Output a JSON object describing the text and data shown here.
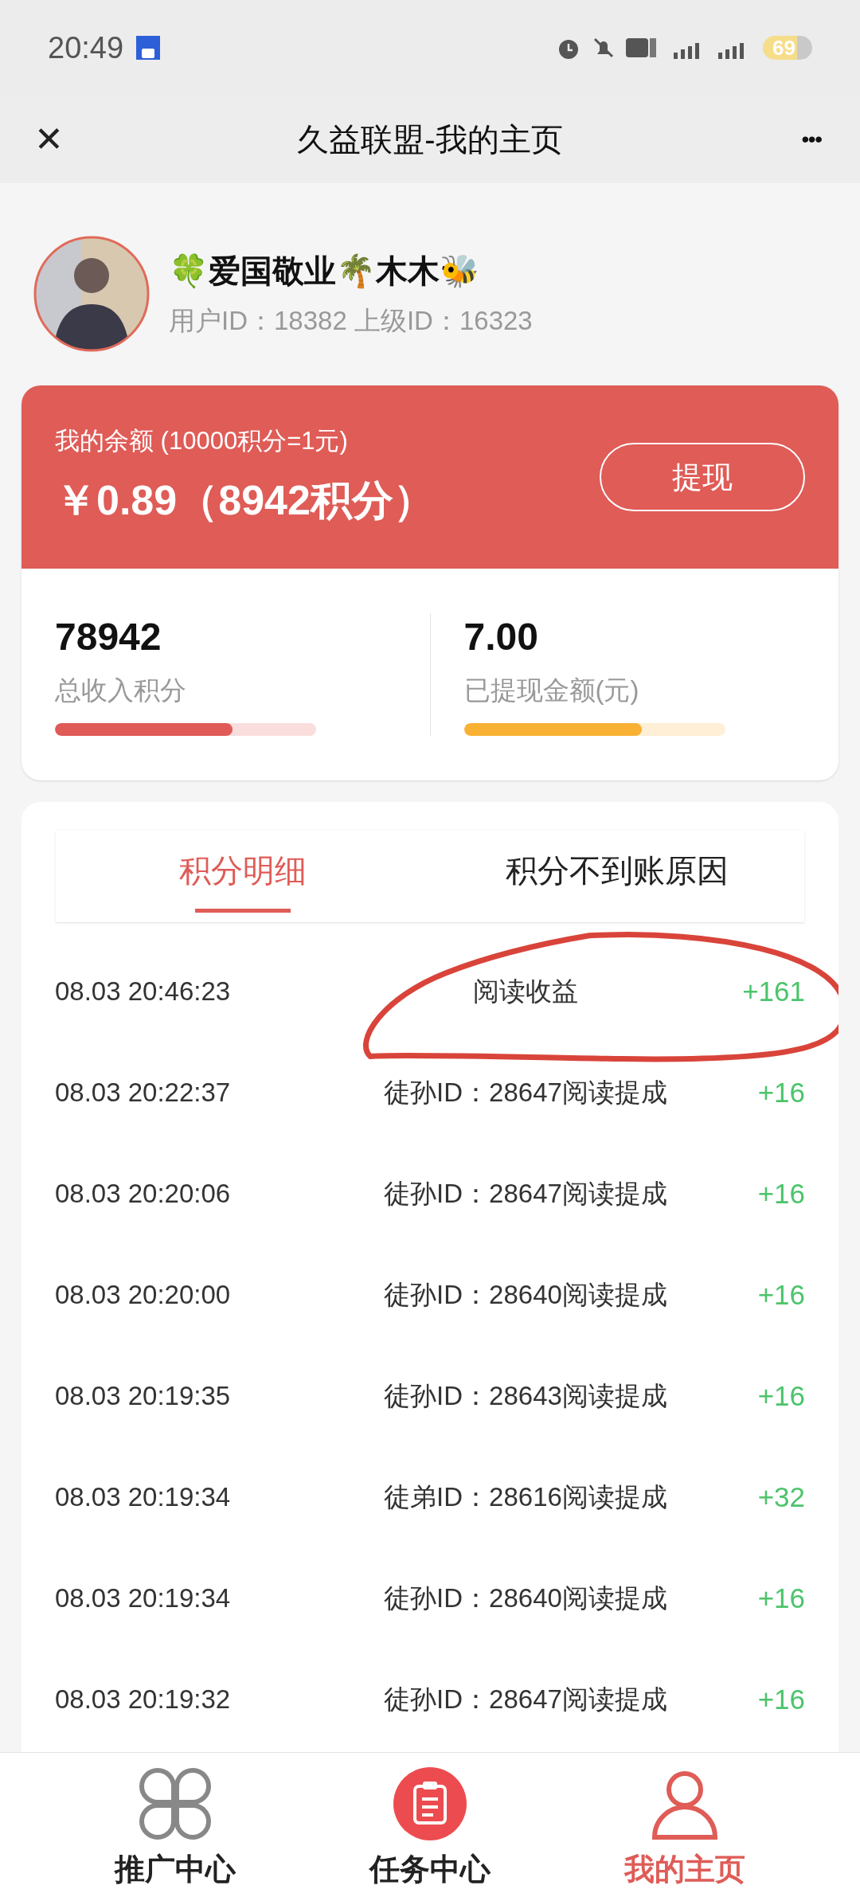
{
  "status_bar": {
    "time": "20:49",
    "battery": "69"
  },
  "header": {
    "close": "✕",
    "title": "久益联盟-我的主页",
    "more": "•••"
  },
  "profile": {
    "name": "🍀爱国敬业🌴木木🐝",
    "ids": "用户ID：18382 上级ID：16323"
  },
  "balance": {
    "label": "我的余额 (10000积分=1元)",
    "amount": "￥0.89（8942积分）",
    "button": "提现"
  },
  "stats": [
    {
      "value": "78942",
      "label": "总收入积分",
      "level": 0.68,
      "color": "#e05a57"
    },
    {
      "value": "7.00",
      "label": "已提现金额(元)",
      "level": 0.68,
      "color": "#f8b133"
    }
  ],
  "tabs": [
    {
      "label": "积分明细",
      "selected": true
    },
    {
      "label": "积分不到账原因",
      "selected": false
    }
  ],
  "records": [
    {
      "time": "08.03 20:46:23",
      "desc": "阅读收益",
      "amount": "+161"
    },
    {
      "time": "08.03 20:22:37",
      "desc": "徒孙ID：28647阅读提成",
      "amount": "+16"
    },
    {
      "time": "08.03 20:20:06",
      "desc": "徒孙ID：28647阅读提成",
      "amount": "+16"
    },
    {
      "time": "08.03 20:20:00",
      "desc": "徒孙ID：28640阅读提成",
      "amount": "+16"
    },
    {
      "time": "08.03 20:19:35",
      "desc": "徒孙ID：28643阅读提成",
      "amount": "+16"
    },
    {
      "time": "08.03 20:19:34",
      "desc": "徒弟ID：28616阅读提成",
      "amount": "+32"
    },
    {
      "time": "08.03 20:19:34",
      "desc": "徒孙ID：28640阅读提成",
      "amount": "+16"
    },
    {
      "time": "08.03 20:19:32",
      "desc": "徒孙ID：28647阅读提成",
      "amount": "+16"
    }
  ],
  "nav": [
    {
      "label": "推广中心",
      "selected": false
    },
    {
      "label": "任务中心",
      "selected": false
    },
    {
      "label": "我的主页",
      "selected": true
    }
  ]
}
